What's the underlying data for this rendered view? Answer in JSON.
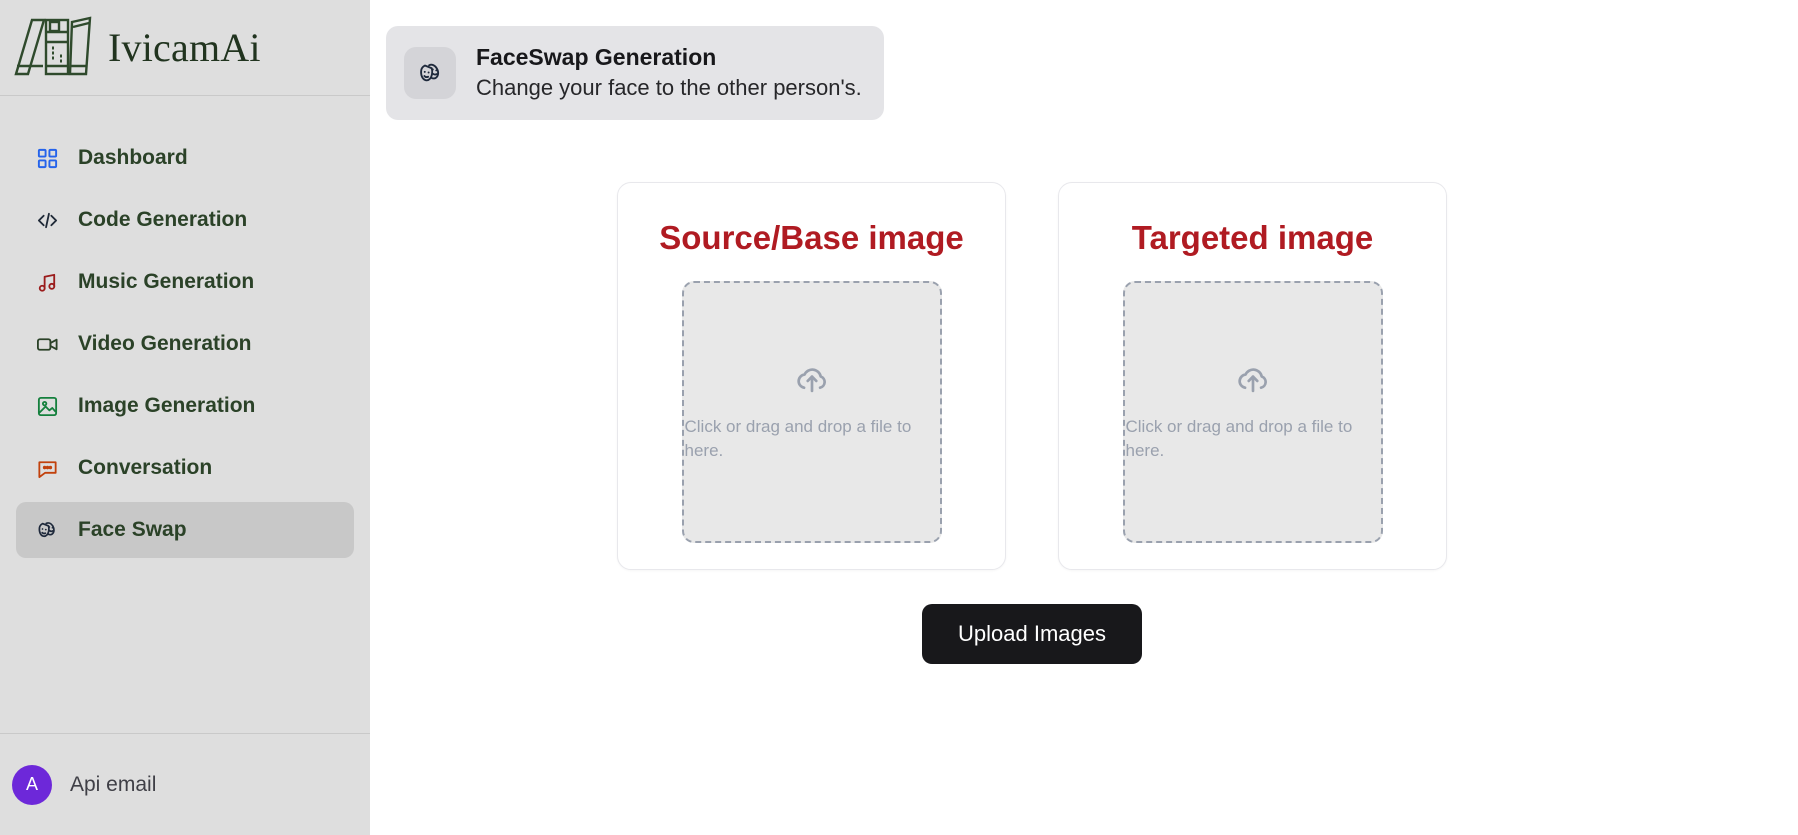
{
  "sidebar": {
    "brand": {
      "name": "IvicamAi",
      "logo_icon": "books-logo-icon"
    },
    "items": [
      {
        "label": "Dashboard",
        "icon": "grid-icon",
        "active": false
      },
      {
        "label": "Code Generation",
        "icon": "code-icon",
        "active": false
      },
      {
        "label": "Music Generation",
        "icon": "music-note-icon",
        "active": false
      },
      {
        "label": "Video Generation",
        "icon": "video-camera-icon",
        "active": false
      },
      {
        "label": "Image Generation",
        "icon": "image-icon",
        "active": false
      },
      {
        "label": "Conversation",
        "icon": "chat-bubble-icon",
        "active": false
      },
      {
        "label": "Face Swap",
        "icon": "theater-masks-icon",
        "active": true
      }
    ],
    "footer": {
      "avatar_initial": "A",
      "user_label": "Api email"
    }
  },
  "header": {
    "icon": "theater-masks-icon",
    "title": "FaceSwap Generation",
    "subtitle": "Change your face to the other person's."
  },
  "cards": [
    {
      "title": "Source/Base image",
      "dropzone_icon": "cloud-upload-icon",
      "dropzone_text": "Click or drag and drop a file to here."
    },
    {
      "title": "Targeted image",
      "dropzone_icon": "cloud-upload-icon",
      "dropzone_text": "Click or drag and drop a file to here."
    }
  ],
  "actions": {
    "upload_button": "Upload Images"
  },
  "colors": {
    "sidebar_bg": "#dedede",
    "active_item_bg": "#c8c8c8",
    "brand_green": "#21341f",
    "nav_label": "#2b4228",
    "card_title_red": "#b01b22",
    "button_bg": "#18181b",
    "avatar_bg": "#6d28d9",
    "header_card_bg": "#e4e4e7",
    "dropzone_bg": "#e8e8e8",
    "dropzone_border": "#9aa1ae"
  }
}
